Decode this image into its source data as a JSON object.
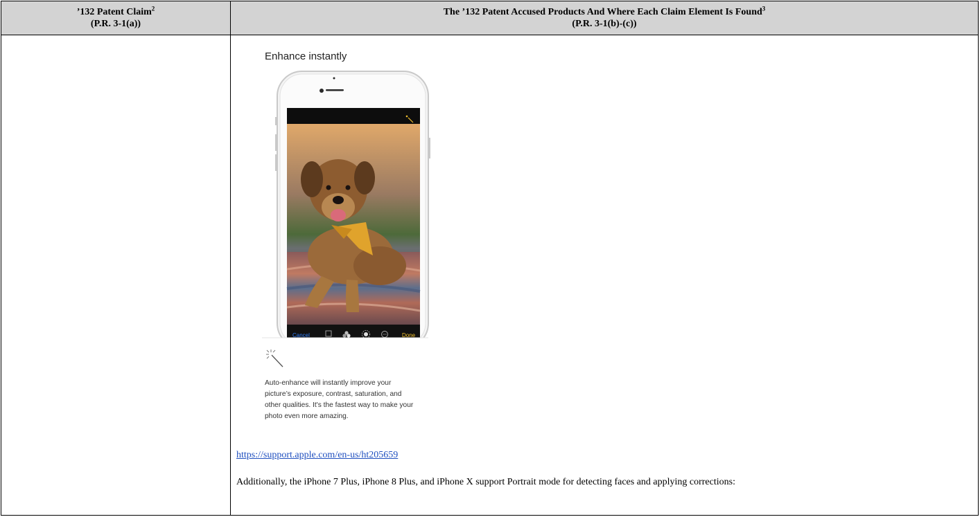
{
  "header": {
    "left_title": "’132 Patent Claim",
    "left_sup": "2",
    "left_sub": "(P.R. 3-1(a))",
    "right_title": "The ’132 Patent Accused Products And Where Each Claim Element Is Found",
    "right_sup": "3",
    "right_sub": "(P.R. 3-1(b)-(c))"
  },
  "figure": {
    "title": "Enhance instantly",
    "toolbar": {
      "cancel": "Cancel",
      "done": "Done"
    },
    "caption_lines": [
      "Auto-enhance will instantly improve your",
      "picture’s exposure, contrast, saturation, and",
      "other qualities. It's the fastest way to make your",
      "photo even more amazing."
    ]
  },
  "source_link": "https://support.apple.com/en-us/ht205659",
  "paragraph": "Additionally, the iPhone 7 Plus, iPhone 8 Plus, and iPhone X support Portrait mode for detecting faces and applying corrections:",
  "colors": {
    "header_bg": "#d3d3d3",
    "link": "#1f4fbf",
    "ios_blue": "#2f7cf6",
    "ios_yellow": "#f2c12e"
  }
}
